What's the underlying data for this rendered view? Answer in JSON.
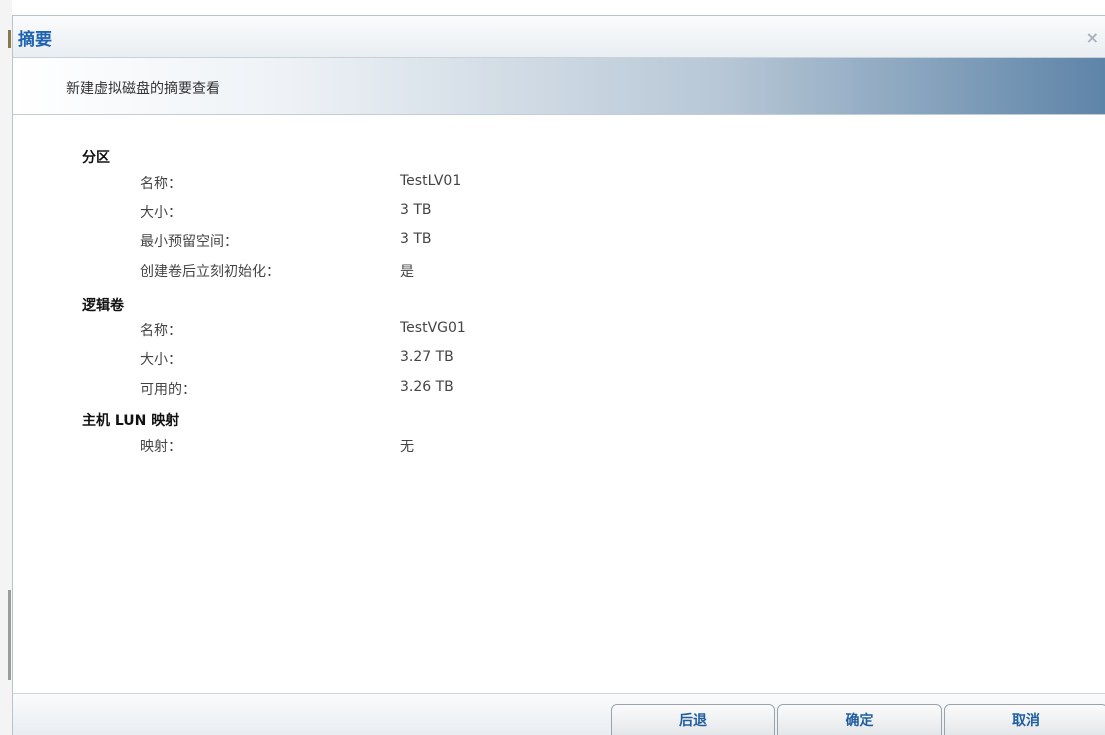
{
  "dialog": {
    "title": "摘要",
    "close_glyph": "×",
    "subtitle": "新建虚拟磁盘的摘要查看"
  },
  "sections": [
    {
      "title": "分区",
      "rows": [
        {
          "label": "名称：",
          "value": "TestLV01"
        },
        {
          "label": "大小：",
          "value": "3 TB"
        },
        {
          "label": "最小预留空间：",
          "value": "3 TB"
        },
        {
          "label": "创建卷后立刻初始化：",
          "value": "是"
        }
      ]
    },
    {
      "title": "逻辑卷",
      "rows": [
        {
          "label": "名称：",
          "value": "TestVG01"
        },
        {
          "label": "大小：",
          "value": "3.27 TB"
        },
        {
          "label": "可用的：",
          "value": "3.26 TB"
        }
      ]
    },
    {
      "title": "主机 LUN 映射",
      "rows": [
        {
          "label": "映射：",
          "value": "无"
        }
      ]
    }
  ],
  "footer": {
    "back_label": "后退",
    "ok_label": "确定",
    "cancel_label": "取消"
  },
  "colors": {
    "title": "#1f63b0",
    "button_text": "#1f5d9f"
  }
}
